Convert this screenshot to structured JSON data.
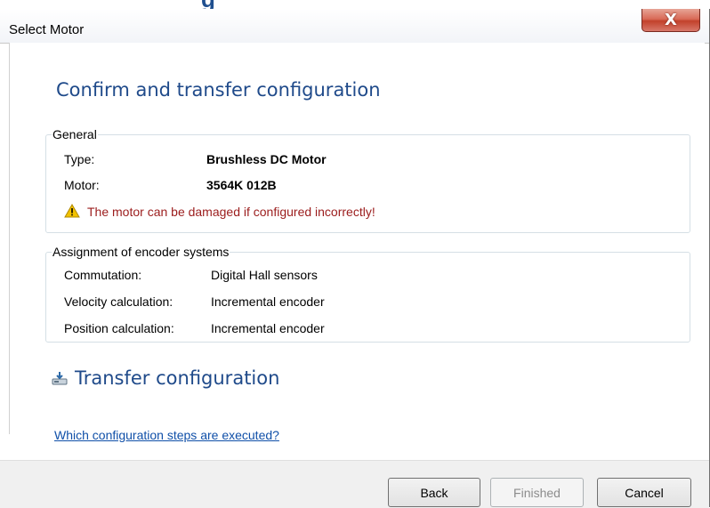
{
  "dialog": {
    "title": "Select Motor",
    "close_glyph": "X",
    "heading": "Confirm and transfer configuration"
  },
  "general": {
    "title": "General",
    "type_label": "Type:",
    "type_value": "Brushless DC Motor",
    "motor_label": "Motor:",
    "motor_value": "3564K 012B",
    "warning": "The motor can be damaged if configured incorrectly!"
  },
  "encoders": {
    "title": "Assignment of encoder systems",
    "rows": [
      {
        "label": "Commutation:",
        "value": "Digital Hall sensors"
      },
      {
        "label": "Velocity calculation:",
        "value": "Incremental encoder"
      },
      {
        "label": "Position calculation:",
        "value": "Incremental encoder"
      }
    ]
  },
  "transfer": {
    "label": "Transfer configuration",
    "icon": "transfer-download-icon"
  },
  "help_link": "Which configuration steps are executed?",
  "buttons": {
    "back": "Back",
    "finished": "Finished",
    "cancel": "Cancel"
  },
  "colors": {
    "heading": "#1f4a8a",
    "warning_text": "#9b1c1c",
    "link": "#0f4fa8",
    "close_button": "#c2412b"
  }
}
